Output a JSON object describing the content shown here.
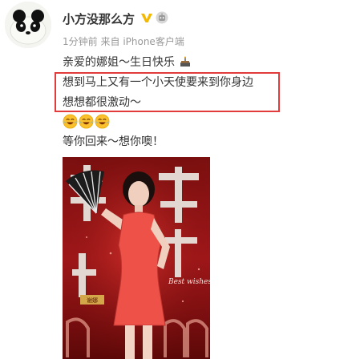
{
  "user": {
    "name": "小方没那么方",
    "avatar_icon": "panda-avatar-icon",
    "verified_icon": "vip-v-icon",
    "badge_icon": "robot-badge-icon"
  },
  "meta": {
    "time": "1分钟前",
    "from_prefix": "来自",
    "source": "iPhone客户端"
  },
  "post": {
    "line1": "亲爱的娜姐～生日快乐",
    "line1_icon": "birthday-cake-icon",
    "line2": "想到马上又有一个小天使要来到你身边",
    "line3": "想想都很激动～",
    "emojis": [
      "grinning-tears-emoji",
      "grinning-tears-emoji",
      "grinning-tears-emoji"
    ],
    "line4": "等你回来～想你噢！"
  },
  "highlight_color": "#e23b3b",
  "poster": {
    "description_icon": "birthday-poster-image",
    "tag": "谢娜",
    "signature": "Best wishes"
  }
}
